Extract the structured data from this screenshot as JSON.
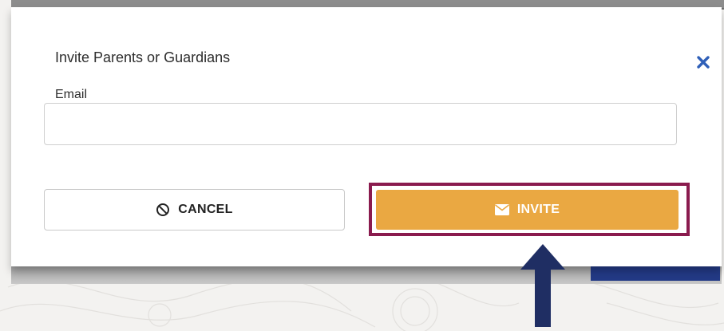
{
  "modal": {
    "title": "Invite Parents or Guardians",
    "email_label": "Email",
    "email_value": "",
    "email_placeholder": "",
    "cancel_label": "CANCEL",
    "invite_label": "INVITE",
    "close_icon": "close-icon",
    "cancel_icon": "ban-icon",
    "invite_icon": "envelope-icon"
  },
  "colors": {
    "invite_button": "#eaa842",
    "highlight_border": "#8a1b4e",
    "annotation_arrow": "#1f2e63",
    "close_icon": "#2f5fb8"
  }
}
